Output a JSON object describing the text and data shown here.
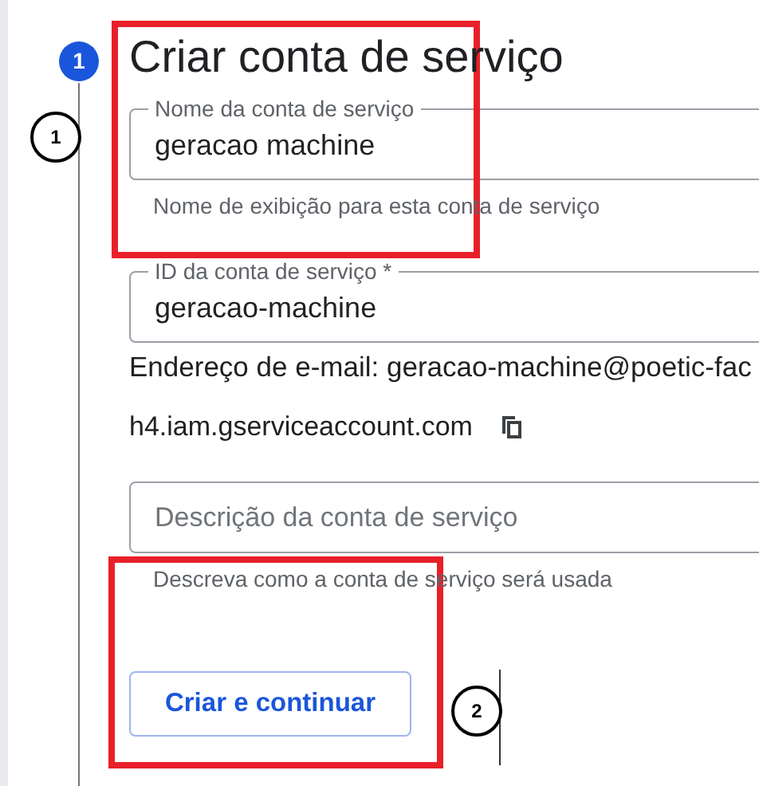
{
  "step": {
    "number": "1",
    "title": "Criar conta de serviço"
  },
  "name_field": {
    "label": "Nome da conta de serviço",
    "value": "geracao machine",
    "hint": "Nome de exibição para esta conta de serviço"
  },
  "id_field": {
    "label": "ID da conta de serviço *",
    "value": "geracao-machine"
  },
  "email": {
    "line1": "Endereço de e-mail: geracao-machine@poetic-fac",
    "line2": "h4.iam.gserviceaccount.com"
  },
  "description_field": {
    "placeholder": "Descrição da conta de serviço",
    "hint": "Descreva como a conta de serviço será usada"
  },
  "button": "Criar e continuar",
  "annotations": [
    {
      "number": "1"
    },
    {
      "number": "2"
    }
  ]
}
